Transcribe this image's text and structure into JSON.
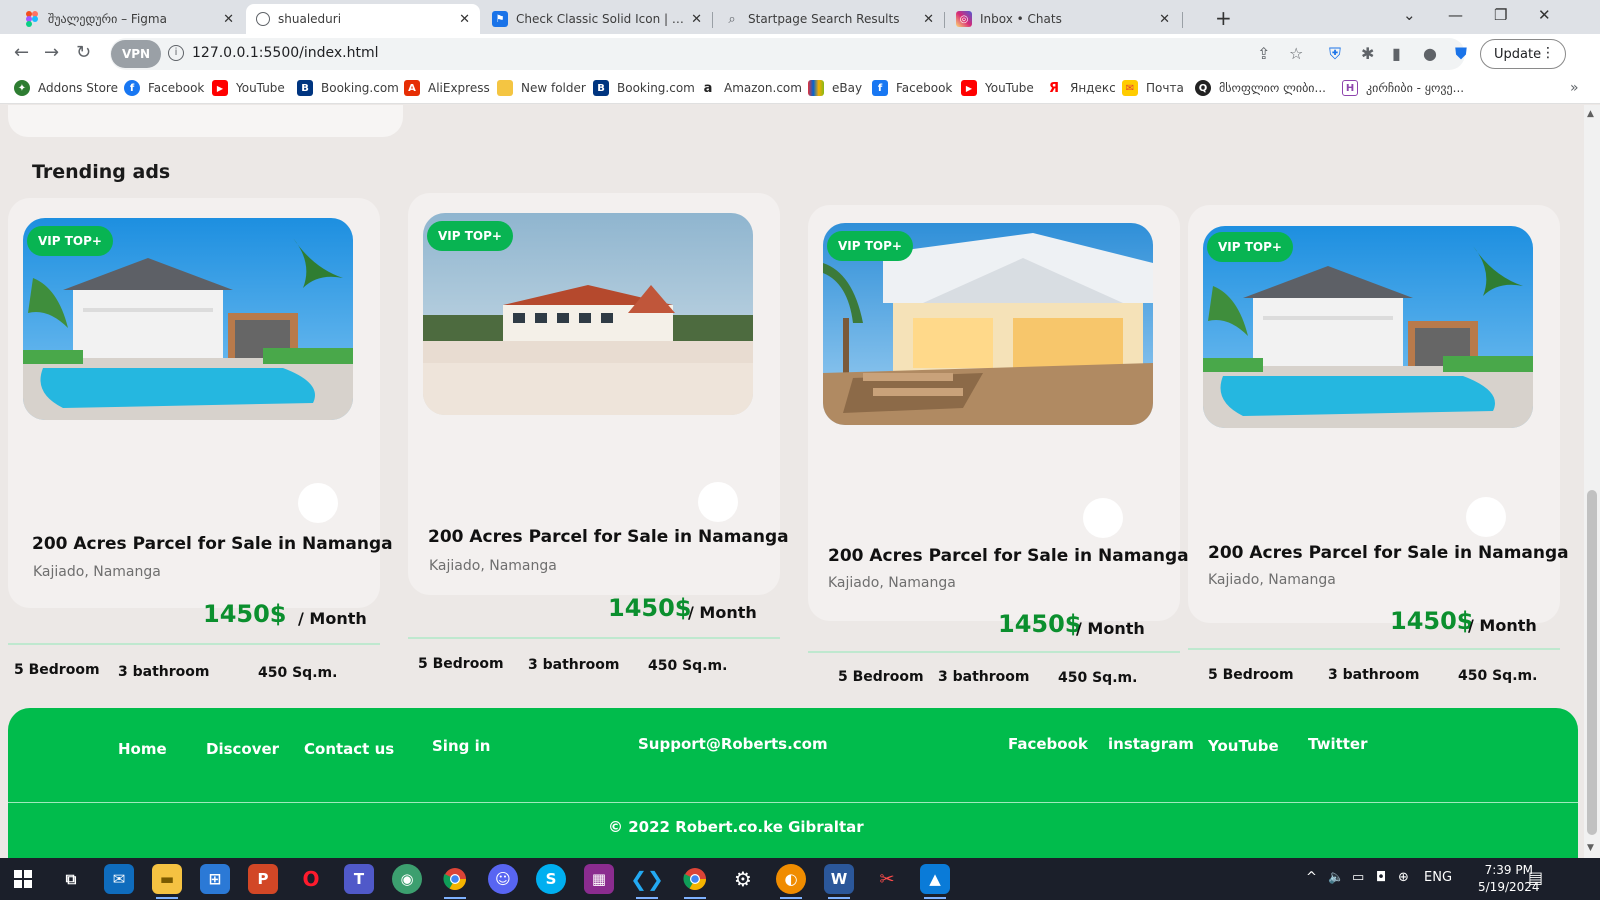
{
  "browser": {
    "tabs": [
      {
        "title": "შუალედური – Figma",
        "icon_color": "#ffffff",
        "icon": "figma-icon"
      },
      {
        "title": "shualeduri",
        "icon_color": "#ffffff",
        "icon": "globe-icon"
      },
      {
        "title": "Check Classic Solid Icon | Font A",
        "icon_color": "#1a73e8",
        "icon": "flag-icon"
      },
      {
        "title": "Startpage Search Results",
        "icon_color": "#ffffff",
        "icon": "search-icon"
      },
      {
        "title": "Inbox • Chats",
        "icon_color": "#d6249f",
        "icon": "instagram-icon"
      }
    ],
    "url": "127.0.0.1:5500/index.html",
    "vpn_label": "VPN",
    "update_label": "Update",
    "bookmarks": [
      {
        "label": "Addons Store",
        "color": "#2e7d32",
        "glyph": "✦"
      },
      {
        "label": "Facebook",
        "color": "#1877f2",
        "glyph": "f"
      },
      {
        "label": "YouTube",
        "color": "#ff0000",
        "glyph": "▶"
      },
      {
        "label": "Booking.com",
        "color": "#003580",
        "glyph": "B"
      },
      {
        "label": "AliExpress",
        "color": "#e62e04",
        "glyph": "A"
      },
      {
        "label": "New folder",
        "color": "#f4c542",
        "glyph": ""
      },
      {
        "label": "Booking.com",
        "color": "#003580",
        "glyph": "B"
      },
      {
        "label": "Amazon.com",
        "color": "#222222",
        "glyph": "a"
      },
      {
        "label": "eBay",
        "color": "#e53238",
        "glyph": "e"
      },
      {
        "label": "Facebook",
        "color": "#1877f2",
        "glyph": "f"
      },
      {
        "label": "YouTube",
        "color": "#ff0000",
        "glyph": "▶"
      },
      {
        "label": "Яндекс",
        "color": "#ff0000",
        "glyph": "Я"
      },
      {
        "label": "Почта",
        "color": "#ffcc00",
        "glyph": "✉"
      },
      {
        "label": "მსოფლიო ლიბი...",
        "color": "#222222",
        "glyph": "Q"
      },
      {
        "label": "კირჩიბი - ყოვე...",
        "color": "#8e44ad",
        "glyph": "H"
      }
    ]
  },
  "page": {
    "section_title": "Trending ads",
    "cards": [
      {
        "badge": "VIP TOP+",
        "title": "200 Acres Parcel for Sale in Namanga",
        "location": "Kajiado, Namanga",
        "price": "1450$",
        "period": "/ Month",
        "bedrooms": "5 Bedroom",
        "bathrooms": "3 bathroom",
        "area": "450 Sq.m.",
        "image": "pool-villa"
      },
      {
        "badge": "VIP TOP+",
        "title": "200 Acres Parcel for Sale in Namanga",
        "location": "Kajiado, Namanga",
        "price": "1450$",
        "period": "/ Month",
        "bedrooms": "5 Bedroom",
        "bathrooms": "3 bathroom",
        "area": "450 Sq.m.",
        "image": "beach-house"
      },
      {
        "badge": "VIP TOP+",
        "title": "200 Acres Parcel for Sale in Namanga",
        "location": "Kajiado, Namanga",
        "price": "1450$",
        "period": "/ Month",
        "bedrooms": "5 Bedroom",
        "bathrooms": "3 bathroom",
        "area": "450 Sq.m.",
        "image": "deck-house"
      },
      {
        "badge": "VIP TOP+",
        "title": "200 Acres Parcel for Sale in Namanga",
        "location": "Kajiado, Namanga",
        "price": "1450$",
        "period": "/ Month",
        "bedrooms": "5 Bedroom",
        "bathrooms": "3 bathroom",
        "area": "450 Sq.m.",
        "image": "pool-villa"
      }
    ],
    "footer": {
      "nav": [
        "Home",
        "Discover",
        "Contact us",
        "Sing in"
      ],
      "email": "Support@Roberts.com",
      "social": [
        "Facebook",
        "instagram",
        "YouTube",
        "Twitter"
      ],
      "copyright": "© 2022 Robert.co.ke Gibraltar"
    },
    "colors": {
      "brand_green": "#01bc4c",
      "price_green": "#0b8f2e",
      "badge_green": "#08b452"
    }
  },
  "taskbar": {
    "language": "ENG",
    "time": "7:39 PM",
    "date": "5/19/2024"
  }
}
